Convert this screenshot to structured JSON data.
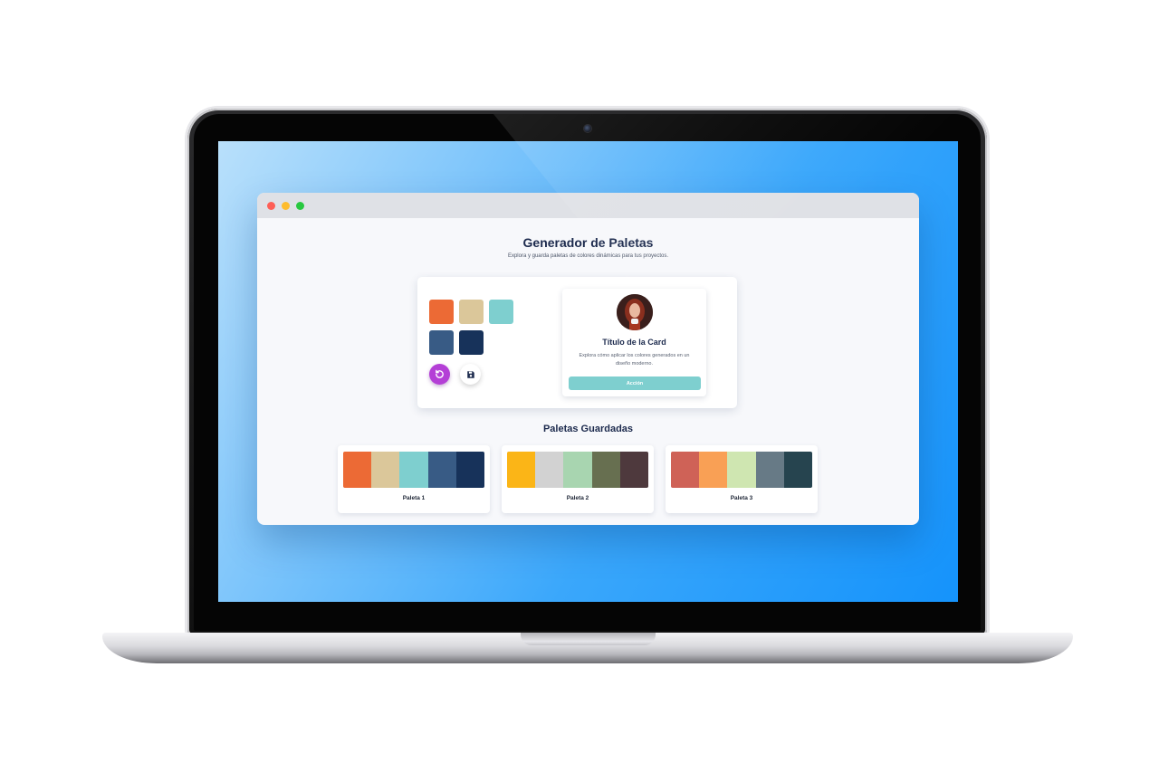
{
  "app": {
    "title": "Generador de Paletas",
    "subtitle": "Explora y guarda paletas de colores dinámicas para tus proyectos."
  },
  "current_palette": [
    "#ec6a35",
    "#dbc79a",
    "#7ecfcf",
    "#385b85",
    "#17325a"
  ],
  "controls": {
    "regenerate_icon": "refresh-icon",
    "save_icon": "floppy-disk-icon",
    "regenerate_color": "#b43fd6"
  },
  "preview_card": {
    "title": "Título de la Card",
    "text": "Explora cómo aplicar los colores generados en un diseño moderno.",
    "action": "Acción",
    "action_color": "#7ecfcf"
  },
  "saved": {
    "title": "Paletas Guardadas",
    "palettes": [
      {
        "name": "Paleta 1",
        "colors": [
          "#ec6a35",
          "#dbc79a",
          "#7ecfcf",
          "#385b85",
          "#17325a"
        ]
      },
      {
        "name": "Paleta 2",
        "colors": [
          "#fbb517",
          "#d2d2d2",
          "#a8d5b0",
          "#676f50",
          "#4e393d"
        ]
      },
      {
        "name": "Paleta 3",
        "colors": [
          "#cf6257",
          "#f9a055",
          "#cfe6b1",
          "#677a86",
          "#26444f"
        ]
      }
    ]
  },
  "colors": {
    "screen_gradient": [
      "#b9e0fb",
      "#1593fb"
    ],
    "heading": "#1c2a4d",
    "window_bg": "#f7f8fb"
  }
}
